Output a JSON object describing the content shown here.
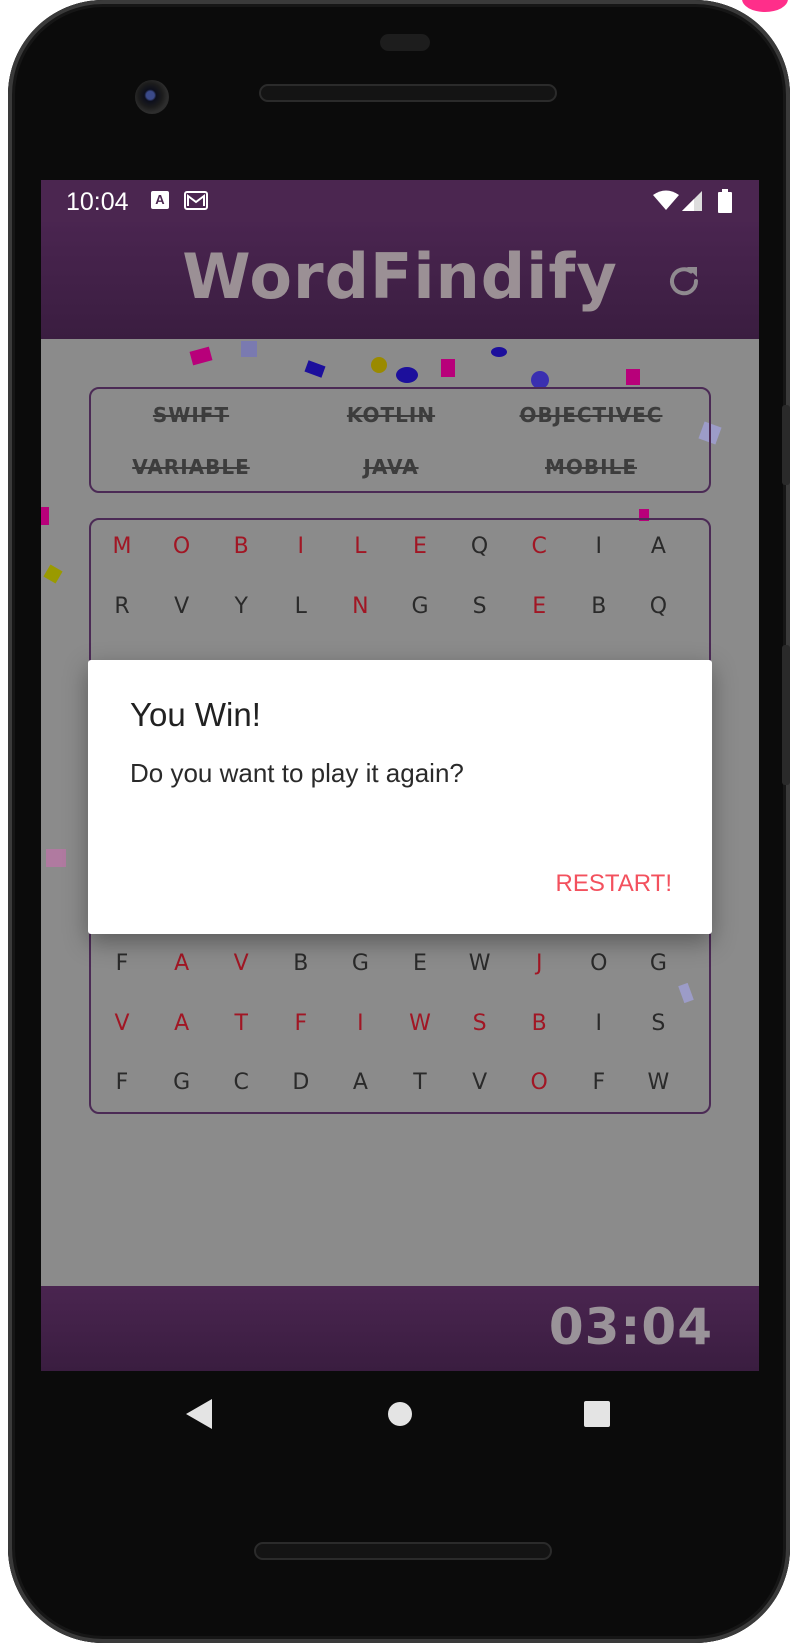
{
  "status_bar": {
    "time": "10:04",
    "notif_icons": [
      "a-icon",
      "gmail-icon"
    ],
    "system_icons": [
      "wifi-icon",
      "signal-icon",
      "battery-icon"
    ]
  },
  "app": {
    "title": "WordFindify",
    "refresh_icon": "refresh-icon"
  },
  "words": [
    "SWIFT",
    "KOTLIN",
    "OBJECTIVEC",
    "VARIABLE",
    "JAVA",
    "MOBILE"
  ],
  "grid_rows_visible": [
    {
      "row": 0,
      "letters": [
        "M",
        "O",
        "B",
        "I",
        "L",
        "E",
        "Q",
        "C",
        "I",
        "A"
      ],
      "found": [
        1,
        1,
        1,
        1,
        1,
        1,
        0,
        1,
        0,
        0
      ]
    },
    {
      "row": 1,
      "letters": [
        "R",
        "V",
        "Y",
        "L",
        "N",
        "G",
        "S",
        "E",
        "B",
        "Q"
      ],
      "found": [
        0,
        0,
        0,
        0,
        1,
        0,
        0,
        1,
        0,
        0
      ]
    },
    {
      "row": 7,
      "letters": [
        "F",
        "A",
        "V",
        "B",
        "G",
        "E",
        "W",
        "J",
        "O",
        "G"
      ],
      "found": [
        0,
        1,
        1,
        0,
        0,
        0,
        0,
        1,
        0,
        0
      ]
    },
    {
      "row": 8,
      "letters": [
        "V",
        "A",
        "T",
        "F",
        "I",
        "W",
        "S",
        "B",
        "I",
        "S"
      ],
      "found": [
        1,
        1,
        1,
        1,
        1,
        1,
        1,
        1,
        0,
        0
      ]
    },
    {
      "row": 9,
      "letters": [
        "F",
        "G",
        "C",
        "D",
        "A",
        "T",
        "V",
        "O",
        "F",
        "W"
      ],
      "found": [
        0,
        0,
        0,
        0,
        0,
        0,
        0,
        1,
        0,
        0
      ]
    }
  ],
  "timer": "03:04",
  "dialog": {
    "title": "You Win!",
    "message": "Do you want to play it again?",
    "button_label": "RESTART!"
  },
  "colors": {
    "primary": "#4b2650",
    "found_letter": "#a11624",
    "dialog_button": "#f3515e"
  },
  "nav": [
    "back-icon",
    "home-icon",
    "recents-icon"
  ]
}
